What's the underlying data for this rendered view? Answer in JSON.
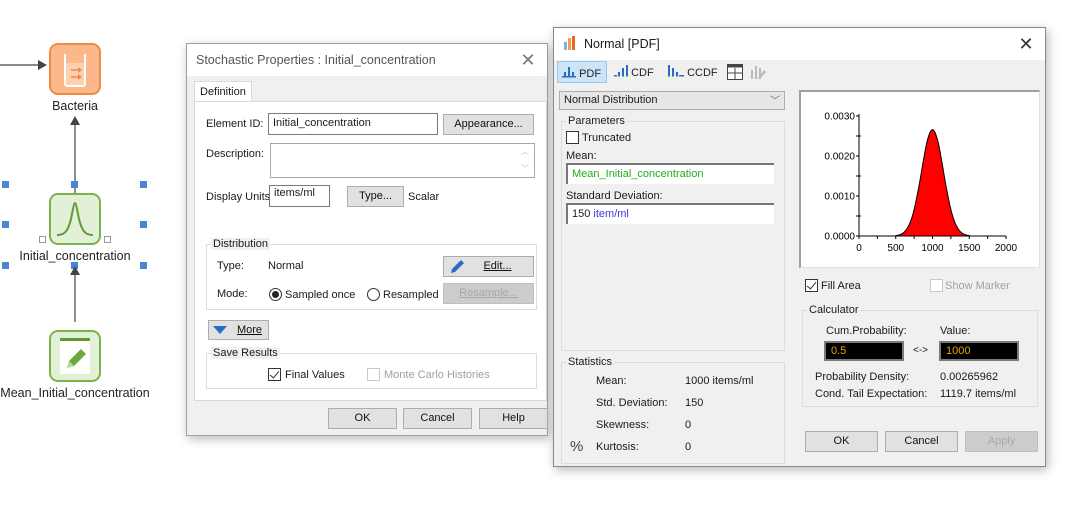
{
  "canvas": {
    "nodes": [
      {
        "id": "bacteria",
        "label": "Bacteria",
        "icon": "reservoir-icon",
        "color": "#f79a5a"
      },
      {
        "id": "initial",
        "label": "Initial_concentration",
        "icon": "normal-distribution-icon",
        "color": "#7ab34a"
      },
      {
        "id": "mean",
        "label": "Mean_Initial_concentration",
        "icon": "data-edit-icon",
        "color": "#7ab34a"
      }
    ]
  },
  "stochastic_dialog": {
    "title": "Stochastic Properties : Initial_concentration",
    "tabs": [
      {
        "label": "Definition",
        "active": true
      }
    ],
    "element_id_label": "Element ID:",
    "element_id_value": "Initial_concentration",
    "appearance_button": "Appearance...",
    "description_label": "Description:",
    "description_value": "",
    "display_units_label": "Display Units:",
    "display_units_value": "items/ml",
    "type_button": "Type...",
    "type_value": "Scalar",
    "distribution": {
      "group_title": "Distribution",
      "type_label": "Type:",
      "type_value": "Normal",
      "edit_button": "Edit...",
      "mode_label": "Mode:",
      "mode_options": [
        "Sampled once",
        "Resampled"
      ],
      "mode_selected": "Sampled once",
      "resample_button": "Resample..."
    },
    "more_button": "More",
    "save_results": {
      "group_title": "Save Results",
      "final_values_label": "Final Values",
      "final_values_checked": true,
      "mc_histories_label": "Monte Carlo Histories",
      "mc_histories_checked": false,
      "mc_histories_enabled": false
    },
    "buttons": {
      "ok": "OK",
      "cancel": "Cancel",
      "help": "Help"
    }
  },
  "pdf_window": {
    "title": "Normal [PDF]",
    "toolbar": [
      {
        "label": "PDF",
        "icon": "pdf-chart-icon",
        "active": true
      },
      {
        "label": "CDF",
        "icon": "cdf-chart-icon",
        "active": false
      },
      {
        "label": "CCDF",
        "icon": "ccdf-chart-icon",
        "active": false
      },
      {
        "label": "",
        "icon": "expand-window-icon",
        "active": false
      },
      {
        "label": "",
        "icon": "chart-edit-icon",
        "active": false,
        "enabled": false
      }
    ],
    "distribution_select": "Normal Distribution",
    "parameters": {
      "group_title": "Parameters",
      "truncated_label": "Truncated",
      "truncated_checked": false,
      "mean_label": "Mean:",
      "mean_value": "Mean_Initial_concentration",
      "sd_label": "Standard Deviation:",
      "sd_number": "150",
      "sd_unit": "item/ml"
    },
    "statistics": {
      "group_title": "Statistics",
      "percent_icon": "%",
      "rows": [
        {
          "label": "Mean:",
          "value": "1000 items/ml"
        },
        {
          "label": "Std. Deviation:",
          "value": "150"
        },
        {
          "label": "Skewness:",
          "value": "0"
        },
        {
          "label": "Kurtosis:",
          "value": "0"
        }
      ]
    },
    "fill_area_label": "Fill Area",
    "fill_area_checked": true,
    "show_marker_label": "Show Marker",
    "show_marker_checked": false,
    "calculator": {
      "group_title": "Calculator",
      "cum_prob_label": "Cum.Probability:",
      "value_label": "Value:",
      "cum_prob_value": "0.5",
      "arrow": "<->",
      "value_value": "1000",
      "prob_density_label": "Probability Density:",
      "prob_density_value": "0.00265962",
      "cte_label": "Cond. Tail Expectation:",
      "cte_value": "1119.7 items/ml"
    },
    "buttons": {
      "ok": "OK",
      "cancel": "Cancel",
      "apply": "Apply"
    }
  },
  "chart_data": {
    "type": "area",
    "title": "",
    "xlabel": "",
    "ylabel": "",
    "distribution": "normal",
    "mean": 1000,
    "sd": 150,
    "xlim": [
      0,
      2000
    ],
    "ylim": [
      0,
      0.003
    ],
    "x_ticks": [
      "0",
      "500",
      "1000",
      "1500",
      "2000"
    ],
    "y_ticks": [
      "0.0000",
      "0.0010",
      "0.0020",
      "0.0030"
    ],
    "peak_density": 0.00265962,
    "fill_color": "#ff0000",
    "grid": false,
    "legend": "none"
  }
}
